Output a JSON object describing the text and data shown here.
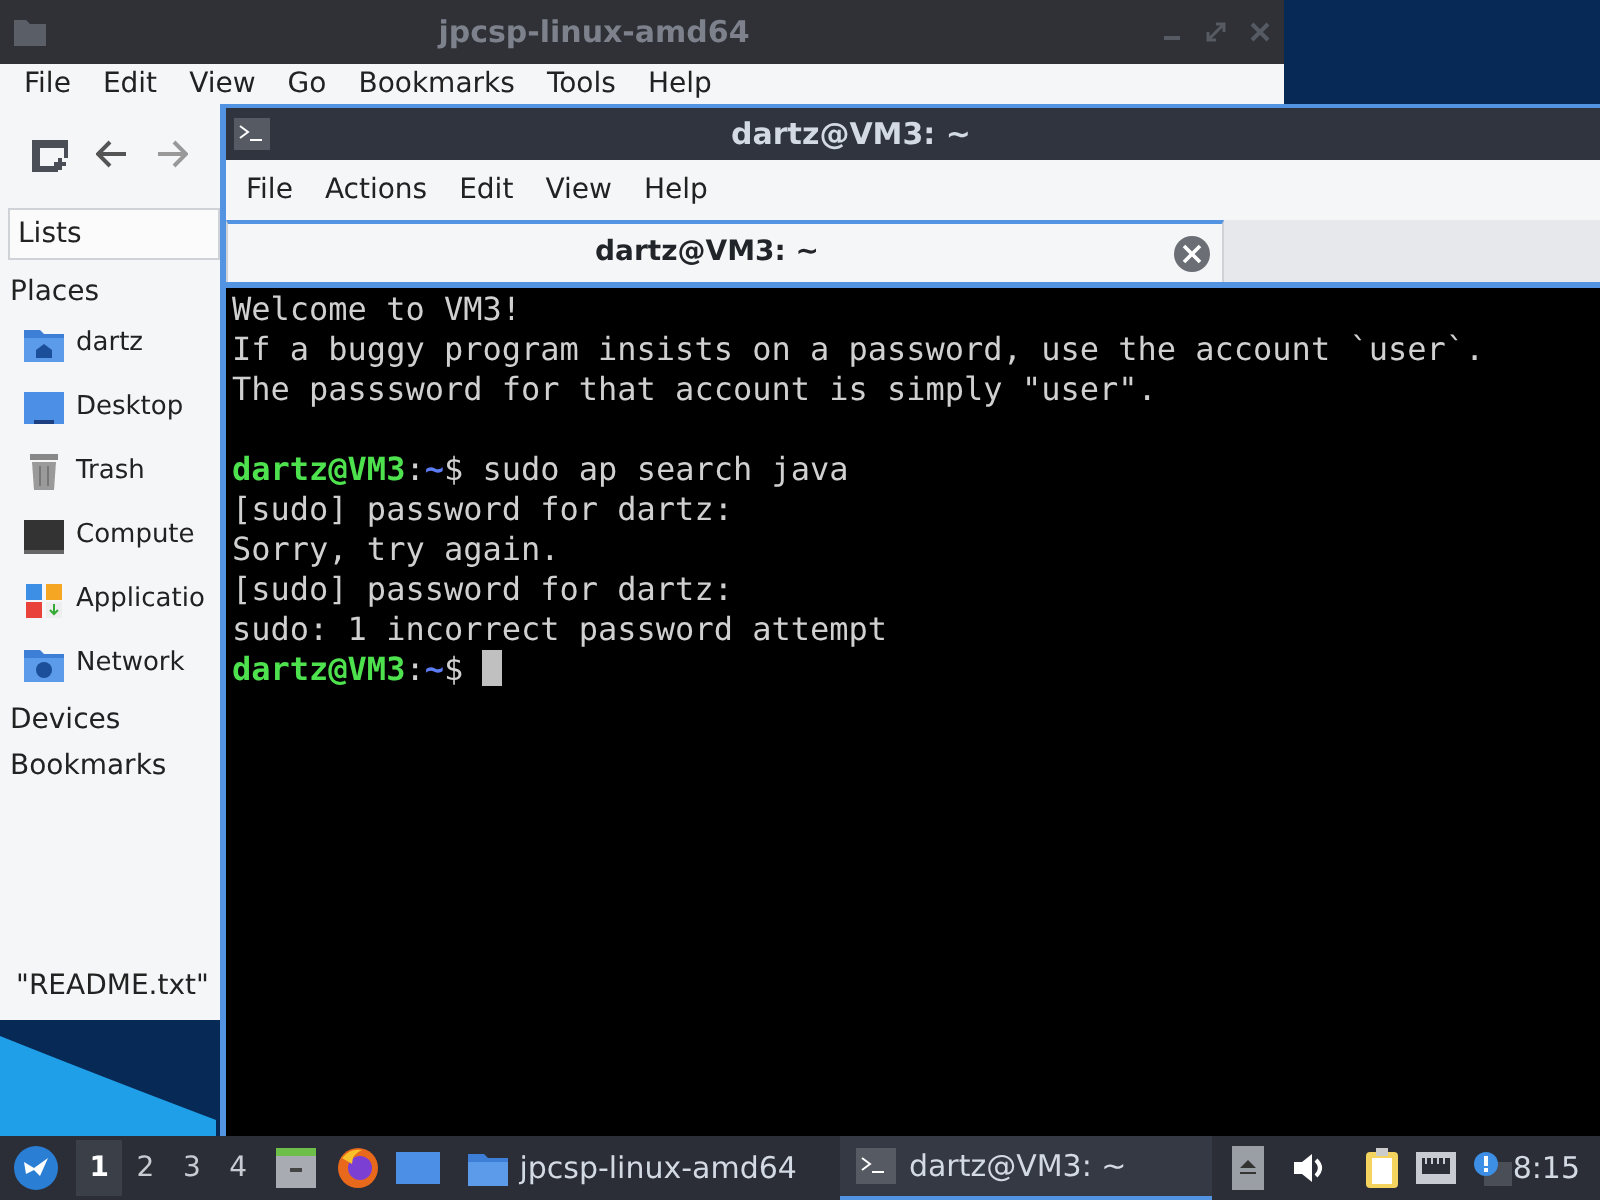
{
  "file_manager": {
    "title": "jpcsp-linux-amd64",
    "menu": [
      "File",
      "Edit",
      "View",
      "Go",
      "Bookmarks",
      "Tools",
      "Help"
    ],
    "sidebar_dropdown": "Lists",
    "places_header": "Places",
    "places": [
      {
        "label": "dartz"
      },
      {
        "label": "Desktop"
      },
      {
        "label": "Trash"
      },
      {
        "label": "Compute"
      },
      {
        "label": "Applicatio"
      },
      {
        "label": "Network"
      }
    ],
    "sections": [
      "Devices",
      "Bookmarks"
    ],
    "status": "\"README.txt\""
  },
  "terminal": {
    "title": "dartz@VM3: ~",
    "menu": [
      "File",
      "Actions",
      "Edit",
      "View",
      "Help"
    ],
    "tabs": [
      {
        "label": "dartz@VM3: ~",
        "selected": true
      }
    ],
    "lines": [
      {
        "kind": "text",
        "text": "Welcome to VM3!"
      },
      {
        "kind": "text",
        "text": "If a buggy program insists on a password, use the account `user`."
      },
      {
        "kind": "text",
        "text": "The passsword for that account is simply \"user\"."
      },
      {
        "kind": "blank"
      },
      {
        "kind": "prompt",
        "user": "dartz@VM3",
        "sep": ":",
        "path": "~",
        "symbol": "$",
        "command": "sudo ap search java",
        "cursor": false
      },
      {
        "kind": "text",
        "text": "[sudo] password for dartz:"
      },
      {
        "kind": "text",
        "text": "Sorry, try again."
      },
      {
        "kind": "text",
        "text": "[sudo] password for dartz:"
      },
      {
        "kind": "text",
        "text": "sudo: 1 incorrect password attempt"
      },
      {
        "kind": "prompt",
        "user": "dartz@VM3",
        "sep": ":",
        "path": "~",
        "symbol": "$",
        "cursor": true
      }
    ]
  },
  "taskbar": {
    "workspaces": [
      {
        "label": "1",
        "selected": true
      },
      {
        "label": "2",
        "selected": false
      },
      {
        "label": "3",
        "selected": false
      },
      {
        "label": "4",
        "selected": false
      }
    ],
    "tasks": [
      {
        "label": "jpcsp-linux-amd64",
        "selected": false
      },
      {
        "label": "dartz@VM3: ~",
        "selected": true
      }
    ],
    "clock": "8:15"
  }
}
